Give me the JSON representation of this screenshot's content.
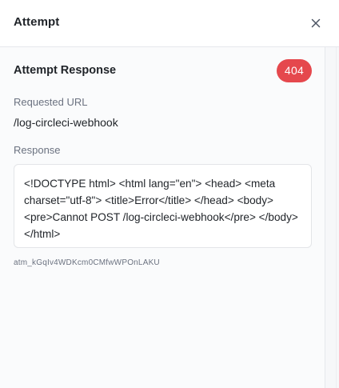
{
  "header": {
    "title": "Attempt",
    "close_icon": "close-icon"
  },
  "attempt": {
    "section_title": "Attempt Response",
    "status_code": "404",
    "status_color": "#e5484d",
    "requested_url_label": "Requested URL",
    "requested_url": "/log-circleci-webhook",
    "response_label": "Response",
    "response_body": "<!DOCTYPE html> <html lang=\"en\"> <head> <meta charset=\"utf-8\"> <title>Error</title> </head> <body> <pre>Cannot POST /log-circleci-webhook</pre> </body> </html>",
    "attempt_id": "atm_kGqIv4WDKcm0CMfwWPOnLAKU"
  }
}
